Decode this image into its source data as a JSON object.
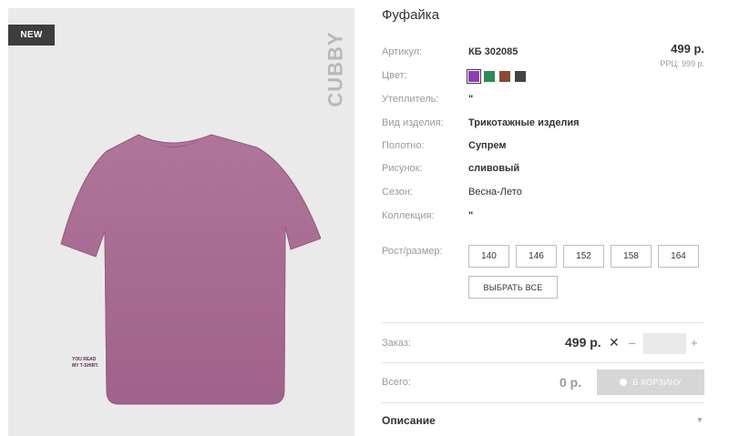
{
  "badge": "NEW",
  "brand_watermark": "CUBBY",
  "print_text": [
    "YOU READ",
    "MY T-SHIRT."
  ],
  "product": {
    "title": "Фуфайка",
    "price": "499 р.",
    "rrp": "РРЦ: 999 р."
  },
  "attributes": [
    {
      "label": "Артикул:",
      "value": "КБ 302085"
    },
    {
      "label": "Цвет:",
      "value": ""
    },
    {
      "label": "Утеплитель:",
      "value": "\""
    },
    {
      "label": "Вид изделия:",
      "value": "Трикотажные изделия"
    },
    {
      "label": "Полотно:",
      "value": "Супрем"
    },
    {
      "label": "Рисунок:",
      "value": "сливовый"
    },
    {
      "label": "Сезон:",
      "value": "Весна-Лето"
    },
    {
      "label": "Коллекция:",
      "value": "\""
    }
  ],
  "colors": [
    {
      "name": "purple",
      "hex": "#8e3db5",
      "selected": true
    },
    {
      "name": "green",
      "hex": "#2f8a55",
      "selected": false
    },
    {
      "name": "brown",
      "hex": "#8a4a33",
      "selected": false
    },
    {
      "name": "dark-gray",
      "hex": "#444444",
      "selected": false
    }
  ],
  "size_label": "Рост/размер:",
  "sizes": [
    "140",
    "146",
    "152",
    "158",
    "164"
  ],
  "select_all": "ВЫБРАТЬ ВСЕ",
  "order": {
    "label": "Заказ:",
    "price": "499 р.",
    "times": "✕",
    "minus": "–",
    "plus": "+",
    "quantity": ""
  },
  "total": {
    "label": "Всего:",
    "value": "0 р."
  },
  "cart_button": "В КОРЗИНУ",
  "description": {
    "label": "Описание",
    "caret": "▼"
  },
  "shirt_color": "#a86b8d"
}
